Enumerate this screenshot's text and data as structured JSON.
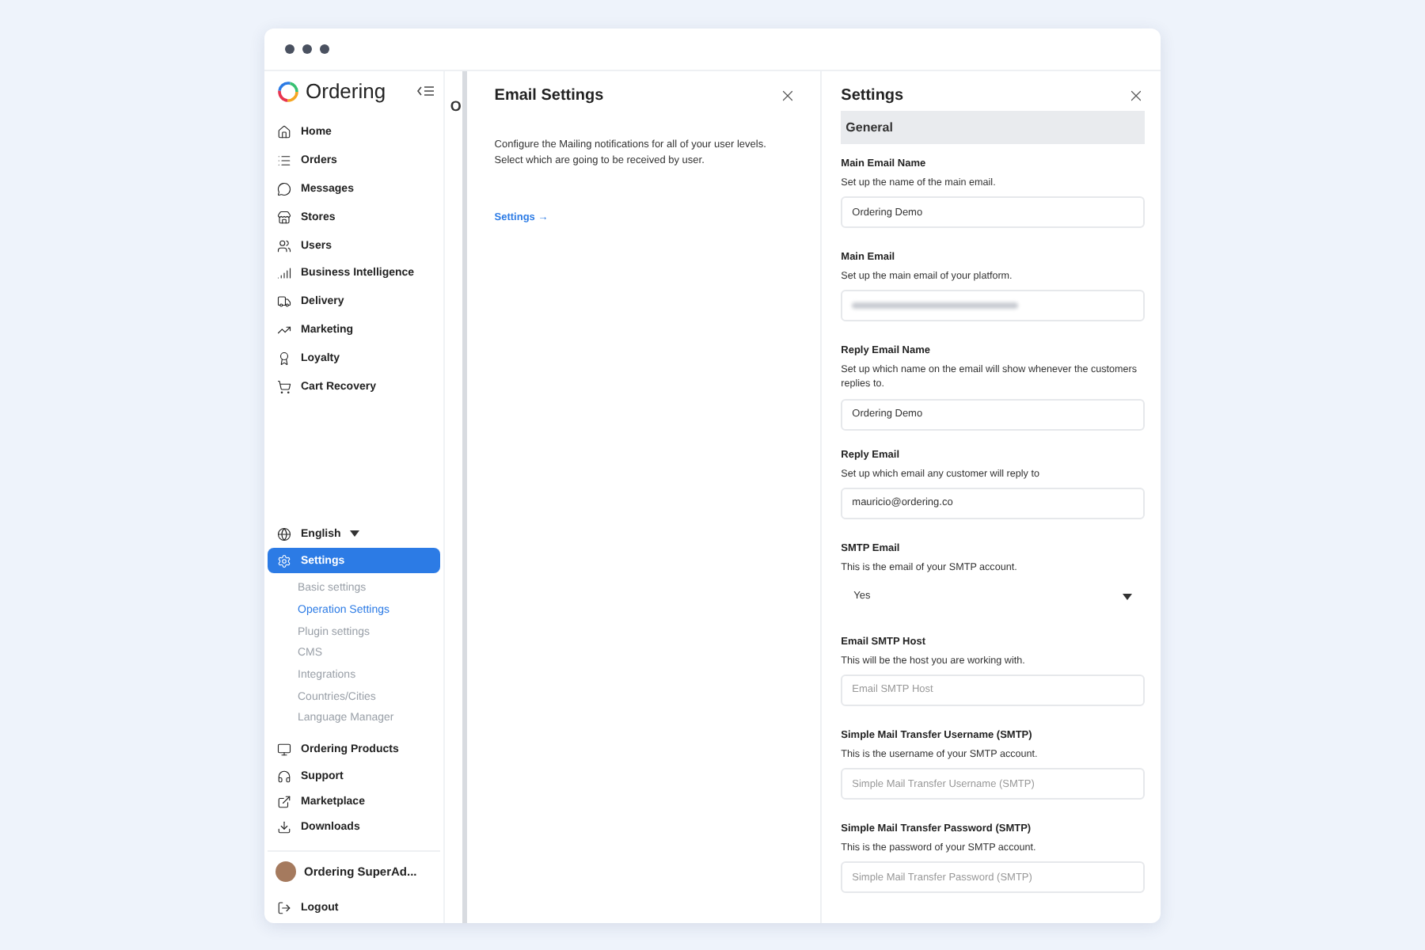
{
  "sidebar": {
    "brand": "Ordering",
    "items": [
      {
        "label": "Home",
        "selected": false
      },
      {
        "label": "Orders",
        "selected": false
      },
      {
        "label": "Messages",
        "selected": false
      },
      {
        "label": "Stores",
        "selected": false
      },
      {
        "label": "Users",
        "selected": false
      },
      {
        "label": "Business Intelligence",
        "selected": false
      },
      {
        "label": "Delivery",
        "selected": false
      },
      {
        "label": "Marketing",
        "selected": false
      },
      {
        "label": "Loyalty",
        "selected": false
      },
      {
        "label": "Cart Recovery",
        "selected": false
      }
    ],
    "language": "English",
    "settings": {
      "label": "Settings",
      "selected": true,
      "expanded": true,
      "children": [
        {
          "label": "Basic settings",
          "selected": false
        },
        {
          "label": "Operation Settings",
          "selected": true
        },
        {
          "label": "Plugin settings",
          "selected": false
        },
        {
          "label": "CMS",
          "selected": false
        },
        {
          "label": "Integrations",
          "selected": false
        },
        {
          "label": "Countries/Cities",
          "selected": false
        },
        {
          "label": "Language Manager",
          "selected": false
        }
      ]
    },
    "bottom_items": [
      {
        "label": "Ordering Products"
      },
      {
        "label": "Support"
      },
      {
        "label": "Marketplace"
      },
      {
        "label": "Downloads"
      }
    ],
    "user": "Ordering SuperAd...",
    "logout": "Logout"
  },
  "page_title_peek": "O",
  "email_panel": {
    "title": "Email Settings",
    "description": "Configure the Mailing notifications for all of your user levels. Select which are going to be received by user.",
    "link": "Settings →"
  },
  "settings_panel": {
    "title": "Settings",
    "section": "General",
    "fields": [
      {
        "kind": "text",
        "label": "Main Email Name",
        "description": "Set up the name of the main email.",
        "value": "Ordering Demo"
      },
      {
        "kind": "blurred",
        "label": "Main Email",
        "description": "Set up the main email of your platform."
      },
      {
        "kind": "text",
        "label": "Reply Email Name",
        "description": "Set up which name on the email will show whenever the customers replies to.",
        "value": "Ordering Demo"
      },
      {
        "kind": "text",
        "label": "Reply Email",
        "description": "Set up which email any customer will reply to",
        "value": "mauricio@ordering.co"
      },
      {
        "kind": "select",
        "label": "SMTP Email",
        "description": "This is the email of your SMTP account.",
        "value": "Yes"
      },
      {
        "kind": "text",
        "label": "Email SMTP Host",
        "description": "This will be the host you are working with.",
        "placeholder": "Email SMTP Host"
      },
      {
        "kind": "text",
        "label": "Simple Mail Transfer Username (SMTP)",
        "description": "This is the username of your SMTP account.",
        "placeholder": "Simple Mail Transfer Username (SMTP)"
      },
      {
        "kind": "text",
        "label": "Simple Mail Transfer Password (SMTP)",
        "description": "This is the password of your SMTP account.",
        "placeholder": "Simple Mail Transfer Password (SMTP)"
      }
    ]
  }
}
